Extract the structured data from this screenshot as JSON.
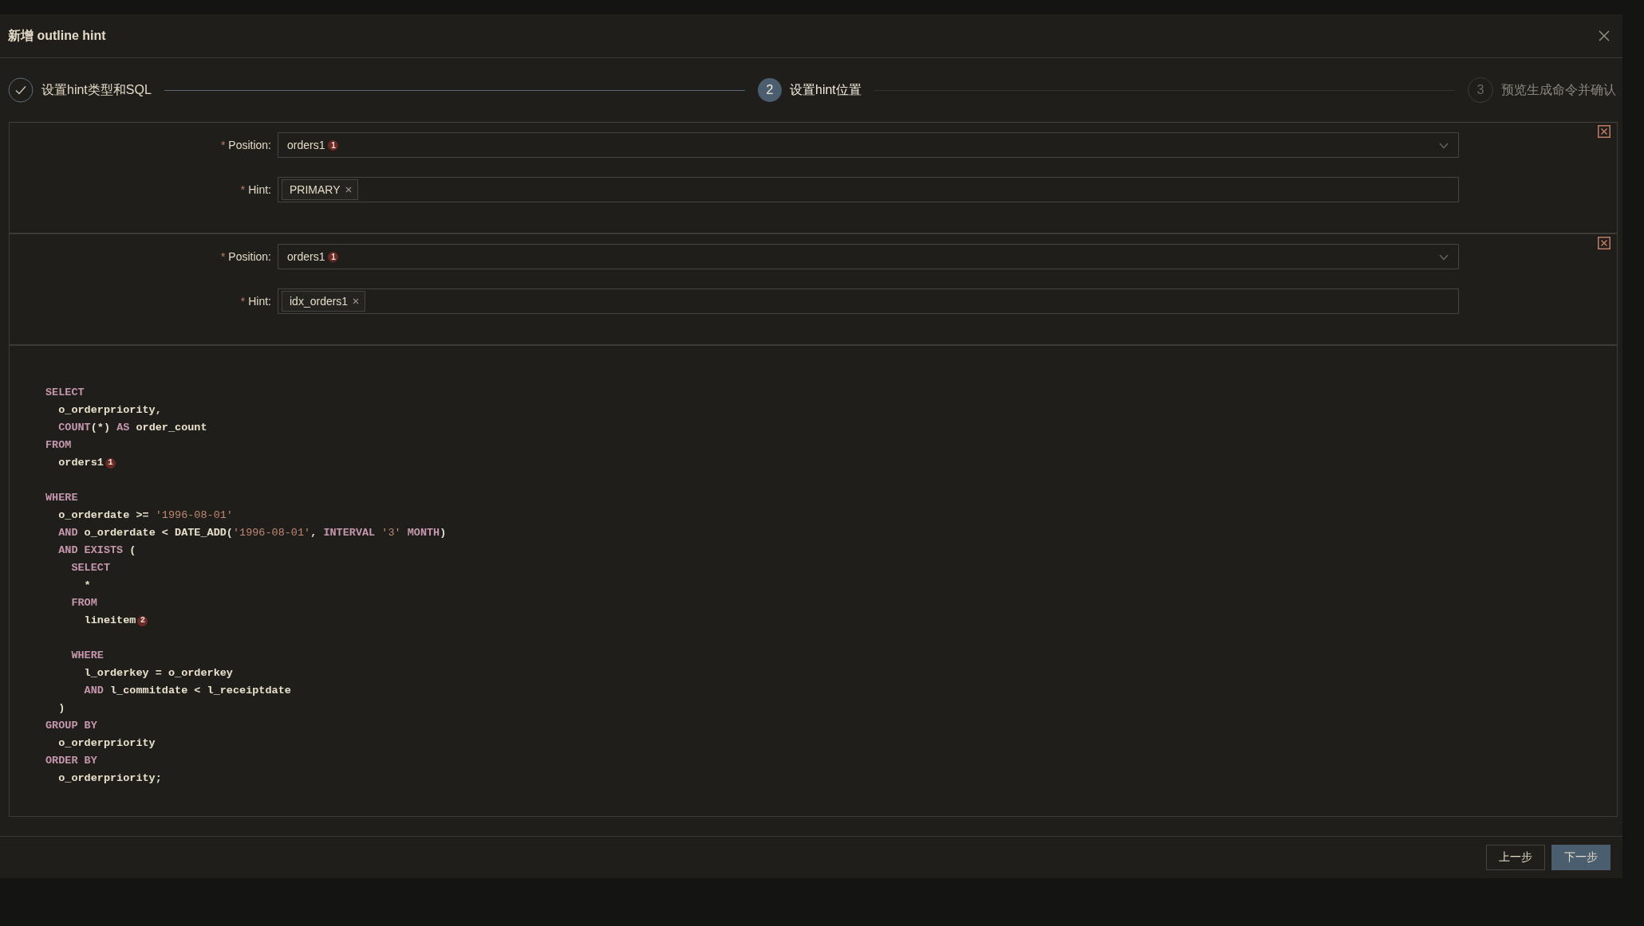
{
  "dialog": {
    "title": "新增 outline hint"
  },
  "steps": [
    {
      "label": "设置hint类型和SQL",
      "done": true,
      "selected": false
    },
    {
      "label": "设置hint位置",
      "done": false,
      "selected": true,
      "number": "2"
    },
    {
      "label": "预览生成命令并确认",
      "done": false,
      "selected": false,
      "number": "3"
    }
  ],
  "hint_blocks": [
    {
      "position_label": "Position:",
      "position_value": "orders1",
      "position_badge": "1",
      "hint_label": "Hint:",
      "hint_tags": [
        "PRIMARY"
      ]
    },
    {
      "position_label": "Position:",
      "position_value": "orders1",
      "position_badge": "1",
      "hint_label": "Hint:",
      "hint_tags": [
        "idx_orders1"
      ]
    }
  ],
  "code_lines": [
    {
      "kind": "blank"
    },
    {
      "kind": "code",
      "tokens": [
        {
          "kind": "keyword",
          "text": "SELECT"
        }
      ]
    },
    {
      "kind": "code",
      "tokens": [
        {
          "kind": "ident",
          "text": "  o_orderpriority,"
        }
      ]
    },
    {
      "kind": "code",
      "tokens": [
        {
          "kind": "keyword",
          "text": "  COUNT"
        },
        {
          "kind": "ident",
          "text": "(*) "
        },
        {
          "kind": "keyword",
          "text": "AS"
        },
        {
          "kind": "ident",
          "text": " order_count"
        }
      ]
    },
    {
      "kind": "code",
      "tokens": [
        {
          "kind": "keyword",
          "text": "FROM"
        }
      ]
    },
    {
      "kind": "code",
      "tokens": [
        {
          "kind": "ident",
          "text": "  orders1"
        },
        {
          "kind": "badge",
          "text": "1"
        }
      ]
    },
    {
      "kind": "blank"
    },
    {
      "kind": "code",
      "tokens": [
        {
          "kind": "keyword",
          "text": "WHERE"
        }
      ]
    },
    {
      "kind": "code",
      "tokens": [
        {
          "kind": "ident",
          "text": "  o_orderdate >= "
        },
        {
          "kind": "string",
          "text": "'1996-08-01'"
        }
      ]
    },
    {
      "kind": "code",
      "tokens": [
        {
          "kind": "keyword",
          "text": "  AND"
        },
        {
          "kind": "ident",
          "text": " o_orderdate < DATE_ADD("
        },
        {
          "kind": "string",
          "text": "'1996-08-01'"
        },
        {
          "kind": "ident",
          "text": ", "
        },
        {
          "kind": "keyword",
          "text": "INTERVAL"
        },
        {
          "kind": "string",
          "text": " '3'"
        },
        {
          "kind": "keyword",
          "text": " MONTH"
        },
        {
          "kind": "ident",
          "text": ")"
        }
      ]
    },
    {
      "kind": "code",
      "tokens": [
        {
          "kind": "keyword",
          "text": "  AND EXISTS"
        },
        {
          "kind": "ident",
          "text": " ("
        }
      ]
    },
    {
      "kind": "code",
      "tokens": [
        {
          "kind": "keyword",
          "text": "    SELECT"
        }
      ]
    },
    {
      "kind": "code",
      "tokens": [
        {
          "kind": "ident",
          "text": "      *"
        }
      ]
    },
    {
      "kind": "code",
      "tokens": [
        {
          "kind": "keyword",
          "text": "    FROM"
        }
      ]
    },
    {
      "kind": "code",
      "tokens": [
        {
          "kind": "ident",
          "text": "      lineitem"
        },
        {
          "kind": "badge",
          "text": "2"
        }
      ]
    },
    {
      "kind": "blank"
    },
    {
      "kind": "code",
      "tokens": [
        {
          "kind": "keyword",
          "text": "    WHERE"
        }
      ]
    },
    {
      "kind": "code",
      "tokens": [
        {
          "kind": "ident",
          "text": "      l_orderkey = o_orderkey"
        }
      ]
    },
    {
      "kind": "code",
      "tokens": [
        {
          "kind": "keyword",
          "text": "      AND"
        },
        {
          "kind": "ident",
          "text": " l_commitdate < l_receiptdate"
        }
      ]
    },
    {
      "kind": "code",
      "tokens": [
        {
          "kind": "ident",
          "text": "  )"
        }
      ]
    },
    {
      "kind": "code",
      "tokens": [
        {
          "kind": "keyword",
          "text": "GROUP BY"
        }
      ]
    },
    {
      "kind": "code",
      "tokens": [
        {
          "kind": "ident",
          "text": "  o_orderpriority"
        }
      ]
    },
    {
      "kind": "code",
      "tokens": [
        {
          "kind": "keyword",
          "text": "ORDER BY"
        }
      ]
    },
    {
      "kind": "code",
      "tokens": [
        {
          "kind": "ident",
          "text": "  o_orderpriority;"
        }
      ]
    }
  ],
  "buttons": [
    {
      "label": "上一步",
      "kind": "secondary"
    },
    {
      "label": "下一步",
      "kind": "primary"
    }
  ]
}
